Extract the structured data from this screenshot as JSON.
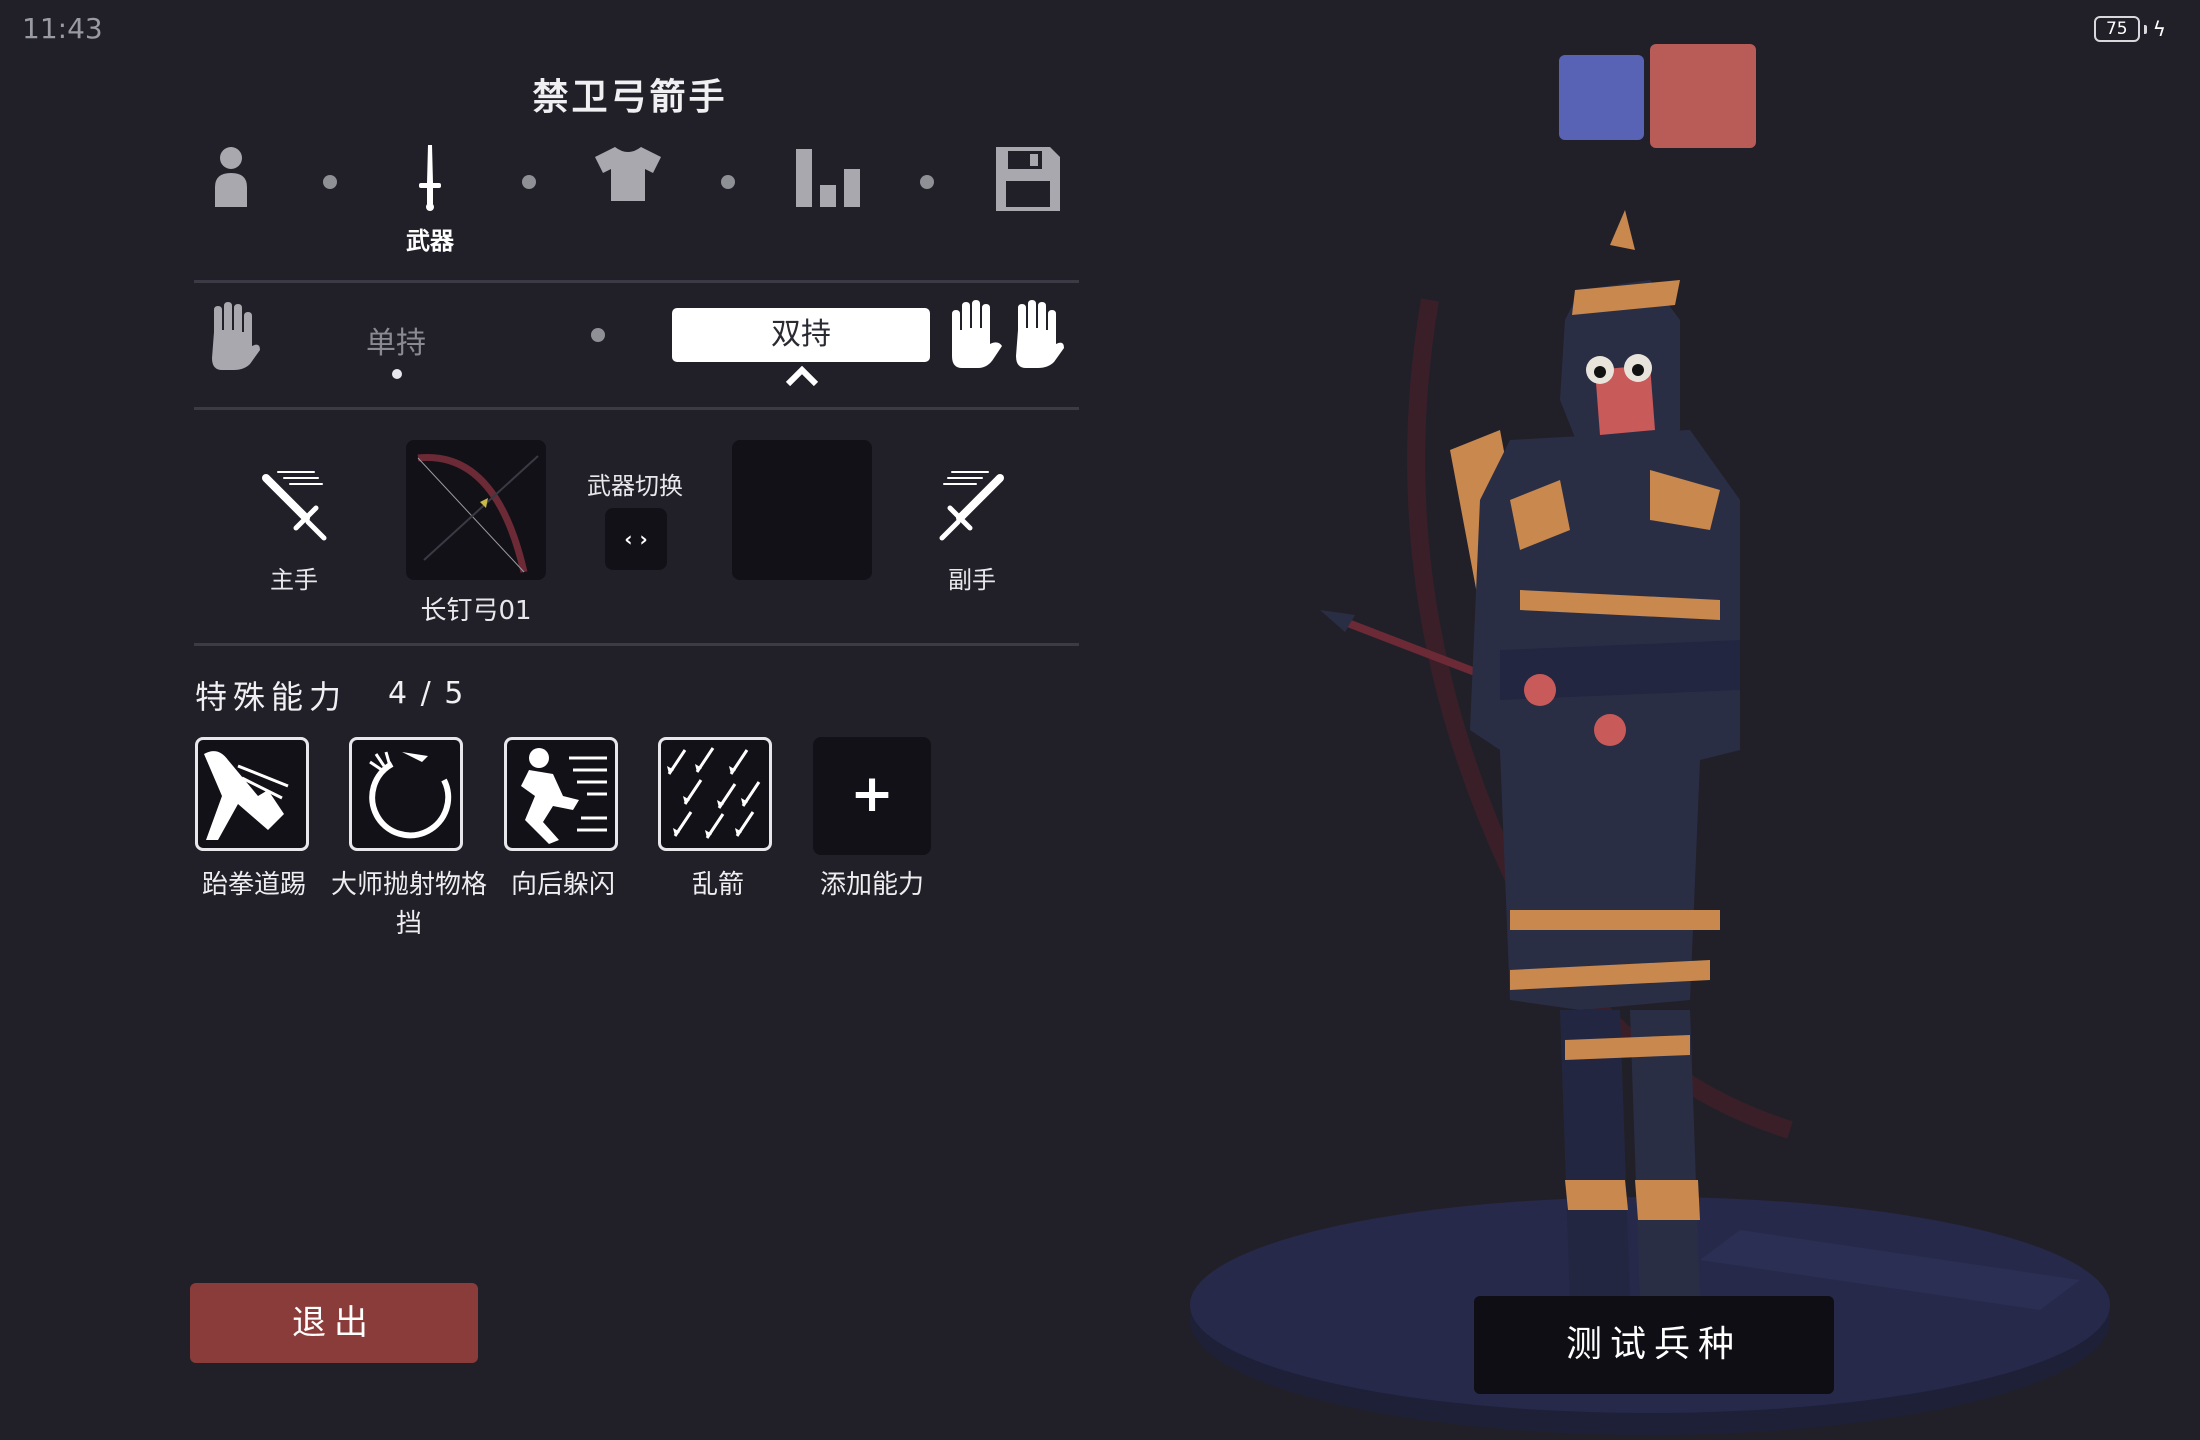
{
  "status": {
    "time": "11:43",
    "battery": "75"
  },
  "unit": {
    "title": "禁卫弓箭手"
  },
  "steps": {
    "weapon_label": "武器"
  },
  "hand_mode": {
    "single_label": "单持",
    "dual_label": "双持"
  },
  "weapons": {
    "main_hand_label": "主手",
    "equipped_name": "长钉弓01",
    "switch_label": "武器切换",
    "switch_symbol": "‹ ›",
    "off_hand_label": "副手"
  },
  "abilities": {
    "title": "特殊能力",
    "count": "4 / 5",
    "items": [
      {
        "label": "跆拳道踢",
        "icon": "kick-icon"
      },
      {
        "label": "大师抛射物格挡",
        "icon": "projectile-block-icon"
      },
      {
        "label": "向后躲闪",
        "icon": "dodge-back-icon"
      },
      {
        "label": "乱箭",
        "icon": "arrow-volley-icon"
      }
    ],
    "add_label": "添加能力",
    "add_symbol": "+"
  },
  "buttons": {
    "exit_label": "退出",
    "test_label": "测试兵种"
  },
  "colors": {
    "background": "#212029",
    "team_blue": "#5863b5",
    "team_red": "#b95b57",
    "exit_button": "#8a3c3a",
    "unit_accent": "#c8884e"
  }
}
